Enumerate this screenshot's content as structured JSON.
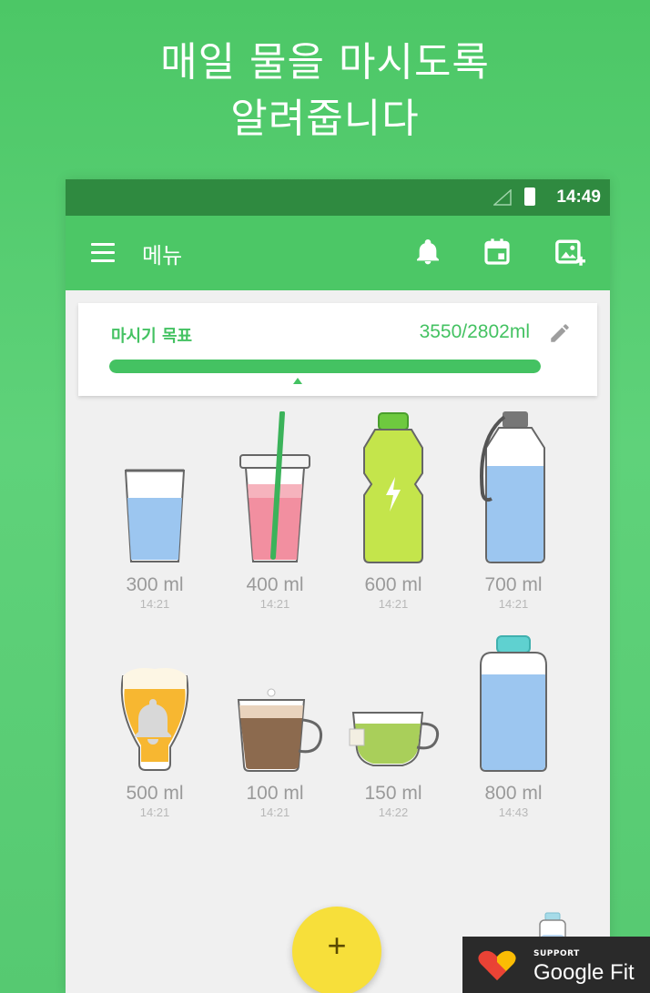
{
  "headline": {
    "line1": "매일 물을 마시도록",
    "line2": "알려줍니다"
  },
  "status_bar": {
    "time": "14:49"
  },
  "app_bar": {
    "title": "메뉴"
  },
  "goal": {
    "label": "마시기 목표",
    "value": "3550/2802ml",
    "progress_fraction": 1.0
  },
  "drinks": [
    {
      "amount": "300 ml",
      "time": "14:21",
      "type": "glass-water"
    },
    {
      "amount": "400 ml",
      "time": "14:21",
      "type": "smoothie-cup"
    },
    {
      "amount": "600 ml",
      "time": "14:21",
      "type": "sports-bottle"
    },
    {
      "amount": "700 ml",
      "time": "14:21",
      "type": "water-flask"
    },
    {
      "amount": "500 ml",
      "time": "14:21",
      "type": "beer-glass"
    },
    {
      "amount": "100 ml",
      "time": "14:21",
      "type": "coffee-cup"
    },
    {
      "amount": "150 ml",
      "time": "14:22",
      "type": "tea-cup"
    },
    {
      "amount": "800 ml",
      "time": "14:43",
      "type": "large-bottle"
    }
  ],
  "fab": {
    "label": "+"
  },
  "google_fit": {
    "support": "SUPPORT",
    "name": "Google Fit"
  },
  "colors": {
    "primary": "#4cc766",
    "status_bar": "#2f8a40",
    "fab": "#f7df3a",
    "water": "#9cc6f0"
  }
}
